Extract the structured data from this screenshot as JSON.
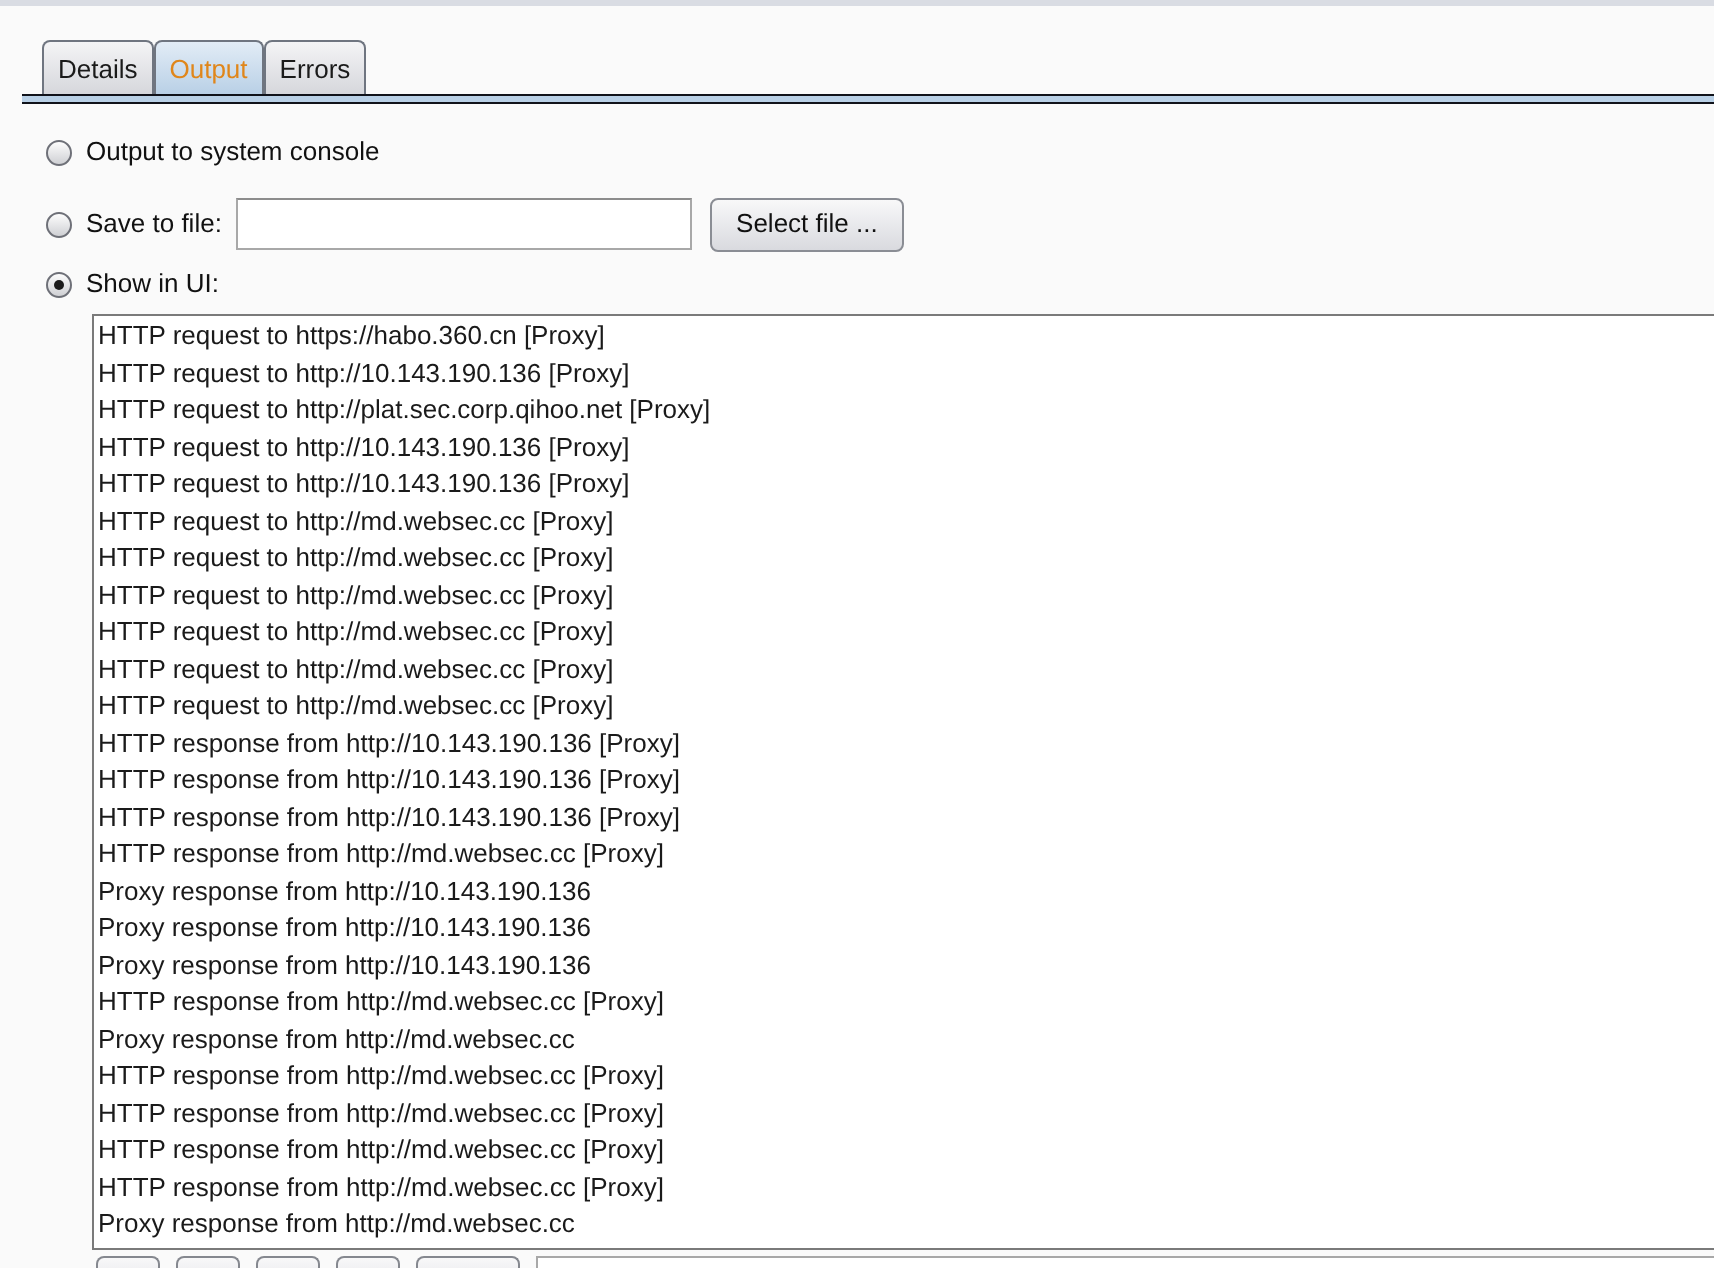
{
  "tabs": [
    {
      "label": "Details",
      "selected": false
    },
    {
      "label": "Output",
      "selected": true
    },
    {
      "label": "Errors",
      "selected": false
    }
  ],
  "output_options": [
    {
      "kind": "plain",
      "label": "Output to system console",
      "selected": false
    },
    {
      "kind": "file",
      "label": "Save to file:",
      "selected": false,
      "button": "Select file ..."
    },
    {
      "kind": "plain",
      "label": "Show in UI:",
      "selected": true
    }
  ],
  "log": {
    "lines": [
      "HTTP request to https://habo.360.cn [Proxy]",
      "HTTP request to http://10.143.190.136 [Proxy]",
      "HTTP request to http://plat.sec.corp.qihoo.net [Proxy]",
      "HTTP request to http://10.143.190.136 [Proxy]",
      "HTTP request to http://10.143.190.136 [Proxy]",
      "HTTP request to http://md.websec.cc [Proxy]",
      "HTTP request to http://md.websec.cc [Proxy]",
      "HTTP request to http://md.websec.cc [Proxy]",
      "HTTP request to http://md.websec.cc [Proxy]",
      "HTTP request to http://md.websec.cc [Proxy]",
      "HTTP request to http://md.websec.cc [Proxy]",
      "HTTP response from http://10.143.190.136 [Proxy]",
      "HTTP response from http://10.143.190.136 [Proxy]",
      "HTTP response from http://10.143.190.136 [Proxy]",
      "HTTP response from http://md.websec.cc [Proxy]",
      "Proxy response from http://10.143.190.136",
      "Proxy response from http://10.143.190.136",
      "Proxy response from http://10.143.190.136",
      "HTTP response from http://md.websec.cc [Proxy]",
      "Proxy response from http://md.websec.cc",
      "HTTP response from http://md.websec.cc [Proxy]",
      "HTTP response from http://md.websec.cc [Proxy]",
      "HTTP response from http://md.websec.cc [Proxy]",
      "HTTP response from http://md.websec.cc [Proxy]",
      "Proxy response from http://md.websec.cc"
    ]
  },
  "bottom_toolbar": [
    {
      "kind": "button"
    },
    {
      "kind": "button"
    },
    {
      "kind": "button"
    },
    {
      "kind": "button"
    },
    {
      "kind": "wide_button"
    },
    {
      "kind": "field"
    }
  ]
}
